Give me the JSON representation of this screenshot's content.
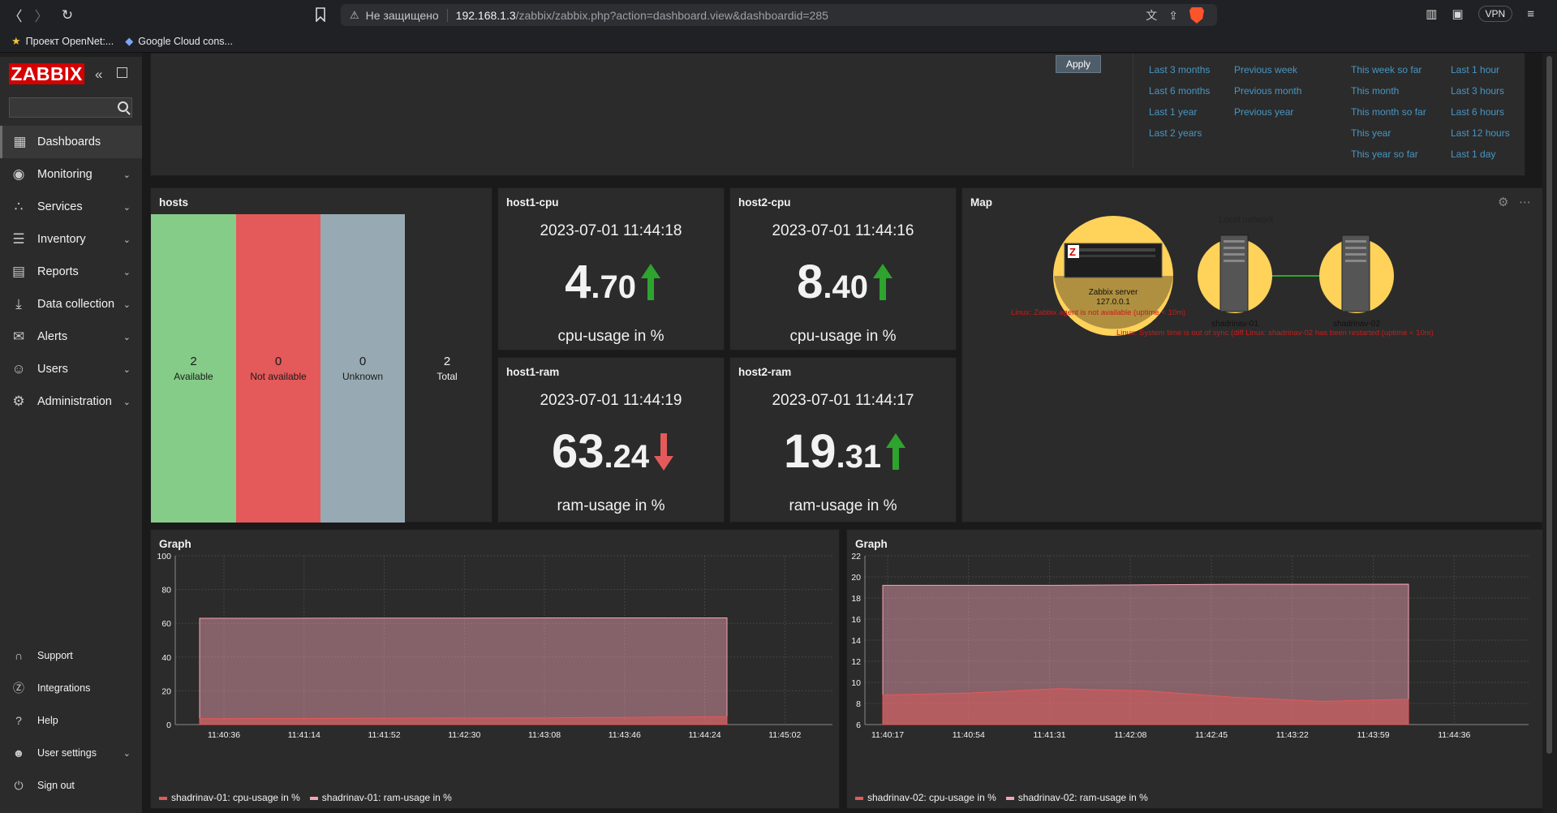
{
  "browser": {
    "insecure_label": "Не защищено",
    "url_host": "192.168.1.3",
    "url_path": "/zabbix/zabbix.php?action=dashboard.view&dashboardid=285",
    "vpn_label": "VPN",
    "bookmarks": [
      "Проект OpenNet:...",
      "Google Cloud cons..."
    ]
  },
  "sidebar": {
    "logo": "ZABBIX",
    "search_placeholder": "",
    "items": [
      {
        "label": "Dashboards",
        "icon": "dashboard-icon",
        "active": true
      },
      {
        "label": "Monitoring",
        "icon": "eye-icon"
      },
      {
        "label": "Services",
        "icon": "services-icon"
      },
      {
        "label": "Inventory",
        "icon": "list-icon"
      },
      {
        "label": "Reports",
        "icon": "report-icon"
      },
      {
        "label": "Data collection",
        "icon": "download-icon"
      },
      {
        "label": "Alerts",
        "icon": "envelope-icon"
      },
      {
        "label": "Users",
        "icon": "users-icon"
      },
      {
        "label": "Administration",
        "icon": "gear-icon"
      }
    ],
    "bottom_items": [
      {
        "label": "Support",
        "icon": "headset-icon"
      },
      {
        "label": "Integrations",
        "icon": "zabbix-z-icon"
      },
      {
        "label": "Help",
        "icon": "question-icon"
      },
      {
        "label": "User settings",
        "icon": "user-icon"
      },
      {
        "label": "Sign out",
        "icon": "power-icon"
      }
    ]
  },
  "filter": {
    "apply_label": "Apply",
    "time_columns": [
      [
        "Last 3 months",
        "Last 6 months",
        "Last 1 year",
        "Last 2 years"
      ],
      [
        "Previous week",
        "Previous month",
        "Previous year"
      ],
      [
        "This week so far",
        "This month",
        "This month so far",
        "This year",
        "This year so far"
      ],
      [
        "Last 1 hour",
        "Last 3 hours",
        "Last 6 hours",
        "Last 12 hours",
        "Last 1 day"
      ]
    ]
  },
  "hosts": {
    "title": "hosts",
    "available": {
      "count": "2",
      "label": "Available",
      "color": "#86cc89"
    },
    "not_available": {
      "count": "0",
      "label": "Not available",
      "color": "#e45959"
    },
    "unknown": {
      "count": "0",
      "label": "Unknown",
      "color": "#97aab3"
    },
    "total": {
      "count": "2",
      "label": "Total"
    }
  },
  "item_values": [
    {
      "title": "host1-cpu",
      "time": "2023-07-01 11:44:18",
      "int": "4",
      "dec": ".70",
      "trend": "up",
      "desc": "cpu-usage in %"
    },
    {
      "title": "host2-cpu",
      "time": "2023-07-01 11:44:16",
      "int": "8",
      "dec": ".40",
      "trend": "up",
      "desc": "cpu-usage in %"
    },
    {
      "title": "host1-ram",
      "time": "2023-07-01 11:44:19",
      "int": "63",
      "dec": ".24",
      "trend": "down",
      "desc": "ram-usage in %"
    },
    {
      "title": "host2-ram",
      "time": "2023-07-01 11:44:17",
      "int": "19",
      "dec": ".31",
      "trend": "up",
      "desc": "ram-usage in %"
    }
  ],
  "map": {
    "title": "Map",
    "group_label": "Local network",
    "server_name": "Zabbix server",
    "server_ip": "127.0.0.1",
    "host1": "shadrinav-01",
    "host2": "shadrinav-02",
    "problem1": "Linux: Zabbix agent is not available (uptime < 10m)",
    "problem2": "Linux: System time is out of sync (diff Linux: shadrinav-02 has been restarted (uptime < 10m)"
  },
  "graph1": {
    "title": "Graph",
    "y_ticks": [
      "100",
      "80",
      "60",
      "40",
      "20",
      "0"
    ],
    "x_ticks": [
      "11:40:36",
      "11:41:14",
      "11:41:52",
      "11:42:30",
      "11:43:08",
      "11:43:46",
      "11:44:24",
      "11:45:02"
    ],
    "legend": [
      "shadrinav-01: cpu-usage in %",
      "shadrinav-01: ram-usage in %"
    ]
  },
  "graph2": {
    "title": "Graph",
    "y_ticks": [
      "22",
      "20",
      "18",
      "16",
      "14",
      "12",
      "10",
      "8",
      "6"
    ],
    "x_ticks": [
      "11:40:17",
      "11:40:54",
      "11:41:31",
      "11:42:08",
      "11:42:45",
      "11:43:22",
      "11:43:59",
      "11:44:36"
    ],
    "legend": [
      "shadrinav-02: cpu-usage in %",
      "shadrinav-02: ram-usage in %"
    ]
  },
  "chart_data": [
    {
      "type": "area",
      "title": "Graph",
      "x": [
        "11:40:36",
        "11:41:14",
        "11:41:52",
        "11:42:30",
        "11:43:08",
        "11:43:46",
        "11:44:24"
      ],
      "ylim": [
        0,
        100
      ],
      "series": [
        {
          "name": "shadrinav-01: cpu-usage in %",
          "values": [
            3.5,
            3.6,
            3.8,
            3.9,
            4.0,
            4.3,
            4.7
          ],
          "color": "#e45959"
        },
        {
          "name": "shadrinav-01: ram-usage in %",
          "values": [
            63.0,
            63.0,
            63.1,
            63.1,
            63.2,
            63.2,
            63.24
          ],
          "color": "#f5a3b5"
        }
      ]
    },
    {
      "type": "area",
      "title": "Graph",
      "x": [
        "11:40:17",
        "11:40:54",
        "11:41:31",
        "11:42:08",
        "11:42:45",
        "11:43:22",
        "11:43:59"
      ],
      "ylim": [
        6,
        22
      ],
      "series": [
        {
          "name": "shadrinav-02: cpu-usage in %",
          "values": [
            8.8,
            9.0,
            9.4,
            9.2,
            8.6,
            8.2,
            8.4
          ],
          "color": "#e45959"
        },
        {
          "name": "shadrinav-02: ram-usage in %",
          "values": [
            19.2,
            19.2,
            19.2,
            19.25,
            19.3,
            19.3,
            19.31
          ],
          "color": "#f5a3b5"
        }
      ]
    }
  ]
}
